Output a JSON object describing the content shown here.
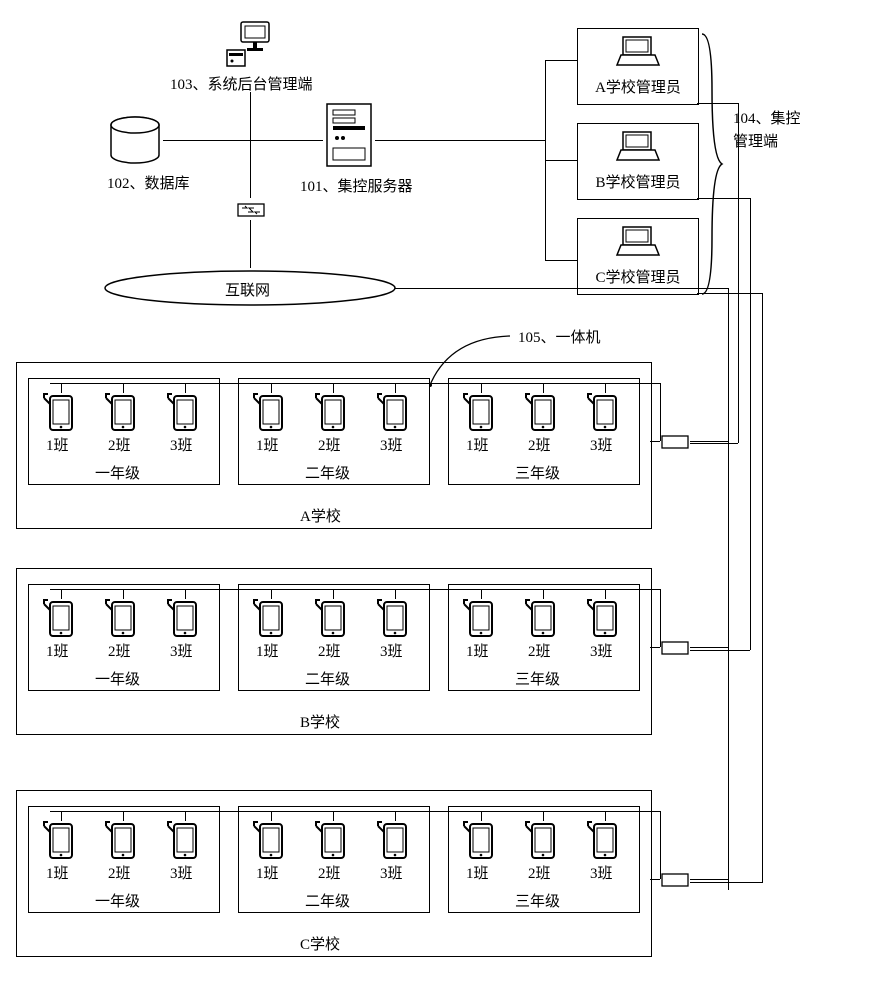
{
  "nodes": {
    "backend": {
      "id": "103",
      "name": "系统后台管理端"
    },
    "database": {
      "id": "102",
      "name": "数据库"
    },
    "server": {
      "id": "101",
      "name": "集控服务器"
    },
    "ctrl_term": {
      "id": "104",
      "name": "集控\n管理端"
    },
    "aio": {
      "id": "105",
      "name": "一体机"
    },
    "internet": "互联网",
    "admins": [
      {
        "key": "a",
        "text": "A学校管理员"
      },
      {
        "key": "b",
        "text": "B学校管理员"
      },
      {
        "key": "c",
        "text": "C学校管理员"
      }
    ]
  },
  "schools": [
    {
      "key": "a",
      "label": "A学校",
      "grades": [
        {
          "label": "一年级",
          "classes": [
            "1班",
            "2班",
            "3班"
          ]
        },
        {
          "label": "二年级",
          "classes": [
            "1班",
            "2班",
            "3班"
          ]
        },
        {
          "label": "三年级",
          "classes": [
            "1班",
            "2班",
            "3班"
          ]
        }
      ]
    },
    {
      "key": "b",
      "label": "B学校",
      "grades": [
        {
          "label": "一年级",
          "classes": [
            "1班",
            "2班",
            "3班"
          ]
        },
        {
          "label": "二年级",
          "classes": [
            "1班",
            "2班",
            "3班"
          ]
        },
        {
          "label": "三年级",
          "classes": [
            "1班",
            "2班",
            "3班"
          ]
        }
      ]
    },
    {
      "key": "c",
      "label": "C学校",
      "grades": [
        {
          "label": "一年级",
          "classes": [
            "1班",
            "2班",
            "3班"
          ]
        },
        {
          "label": "二年级",
          "classes": [
            "1班",
            "2班",
            "3班"
          ]
        },
        {
          "label": "三年级",
          "classes": [
            "1班",
            "2班",
            "3班"
          ]
        }
      ]
    }
  ]
}
